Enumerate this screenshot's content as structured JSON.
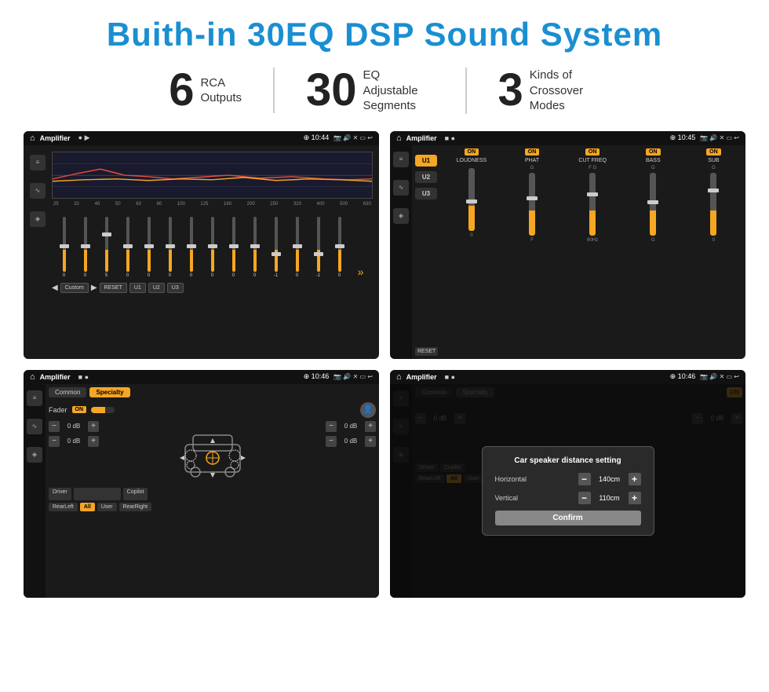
{
  "header": {
    "title": "Buith-in 30EQ DSP Sound System"
  },
  "stats": [
    {
      "number": "6",
      "label_line1": "RCA",
      "label_line2": "Outputs"
    },
    {
      "number": "30",
      "label_line1": "EQ Adjustable",
      "label_line2": "Segments"
    },
    {
      "number": "3",
      "label_line1": "Kinds of",
      "label_line2": "Crossover Modes"
    }
  ],
  "screenshots": [
    {
      "id": "eq",
      "status_bar": {
        "title": "Amplifier",
        "time": "10:44"
      },
      "type": "eq"
    },
    {
      "id": "crossover",
      "status_bar": {
        "title": "Amplifier",
        "time": "10:45"
      },
      "type": "crossover"
    },
    {
      "id": "fader",
      "status_bar": {
        "title": "Amplifier",
        "time": "10:46"
      },
      "type": "fader"
    },
    {
      "id": "distance",
      "status_bar": {
        "title": "Amplifier",
        "time": "10:46"
      },
      "type": "distance",
      "dialog": {
        "title": "Car speaker distance setting",
        "fields": [
          {
            "label": "Horizontal",
            "value": "140cm"
          },
          {
            "label": "Vertical",
            "value": "110cm"
          }
        ],
        "confirm_label": "Confirm"
      }
    }
  ],
  "eq": {
    "freq_labels": [
      "25",
      "32",
      "40",
      "50",
      "63",
      "80",
      "100",
      "125",
      "160",
      "200",
      "250",
      "320",
      "400",
      "500",
      "630"
    ],
    "values": [
      "0",
      "0",
      "0",
      "5",
      "0",
      "0",
      "0",
      "0",
      "0",
      "0",
      "0",
      "-1",
      "0",
      "-1"
    ],
    "presets": [
      "Custom",
      "RESET",
      "U1",
      "U2",
      "U3"
    ]
  },
  "crossover": {
    "presets": [
      "U1",
      "U2",
      "U3"
    ],
    "channels": [
      "LOUDNESS",
      "PHAT",
      "CUT FREQ",
      "BASS",
      "SUB"
    ],
    "reset_label": "RESET"
  },
  "fader": {
    "tabs": [
      "Common",
      "Specialty"
    ],
    "active_tab": "Specialty",
    "fader_label": "Fader",
    "on_label": "ON",
    "db_rows": [
      "0 dB",
      "0 dB",
      "0 dB",
      "0 dB"
    ],
    "bottom_buttons": [
      "Driver",
      "Copilot",
      "RearLeft",
      "All",
      "User",
      "RearRight"
    ]
  },
  "distance_dialog": {
    "title": "Car speaker distance setting",
    "horizontal_label": "Horizontal",
    "horizontal_value": "140cm",
    "vertical_label": "Vertical",
    "vertical_value": "110cm",
    "confirm_label": "Confirm"
  }
}
